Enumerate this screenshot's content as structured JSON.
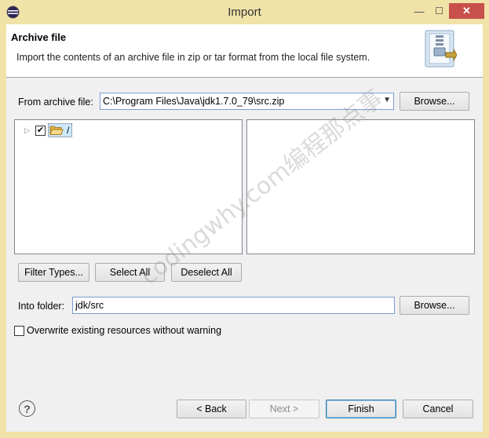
{
  "window": {
    "title": "Import",
    "controls": {
      "minimize": "—",
      "maximize": "☐",
      "close": "✕"
    }
  },
  "banner": {
    "title": "Archive file",
    "description": "Import the contents of an archive file in zip or tar format from the local file system.",
    "graphic_icon": "archive-import-graphic"
  },
  "form": {
    "from_archive_label": "From archive file:",
    "from_archive_value": "C:\\Program Files\\Java\\jdk1.7.0_79\\src.zip",
    "browse_archive_label": "Browse...",
    "into_folder_label": "Into folder:",
    "into_folder_value": "jdk/src",
    "browse_folder_label": "Browse..."
  },
  "tree": {
    "items": [
      {
        "label": "/",
        "checked": true,
        "icon": "open-folder-icon",
        "expander": "▷"
      }
    ]
  },
  "selection_buttons": {
    "filter_types": "Filter Types...",
    "select_all": "Select All",
    "deselect_all": "Deselect All"
  },
  "options": {
    "overwrite_label": "Overwrite existing resources without warning",
    "overwrite_checked": false
  },
  "footer": {
    "help_icon": "?",
    "back": "< Back",
    "next": "Next >",
    "finish": "Finish",
    "cancel": "Cancel"
  },
  "watermark": "codingwhy.com编程那点事",
  "colors": {
    "title_bar": "#f1e2a8",
    "close_button": "#c7504b",
    "selection_highlight": "#cce8ff"
  }
}
